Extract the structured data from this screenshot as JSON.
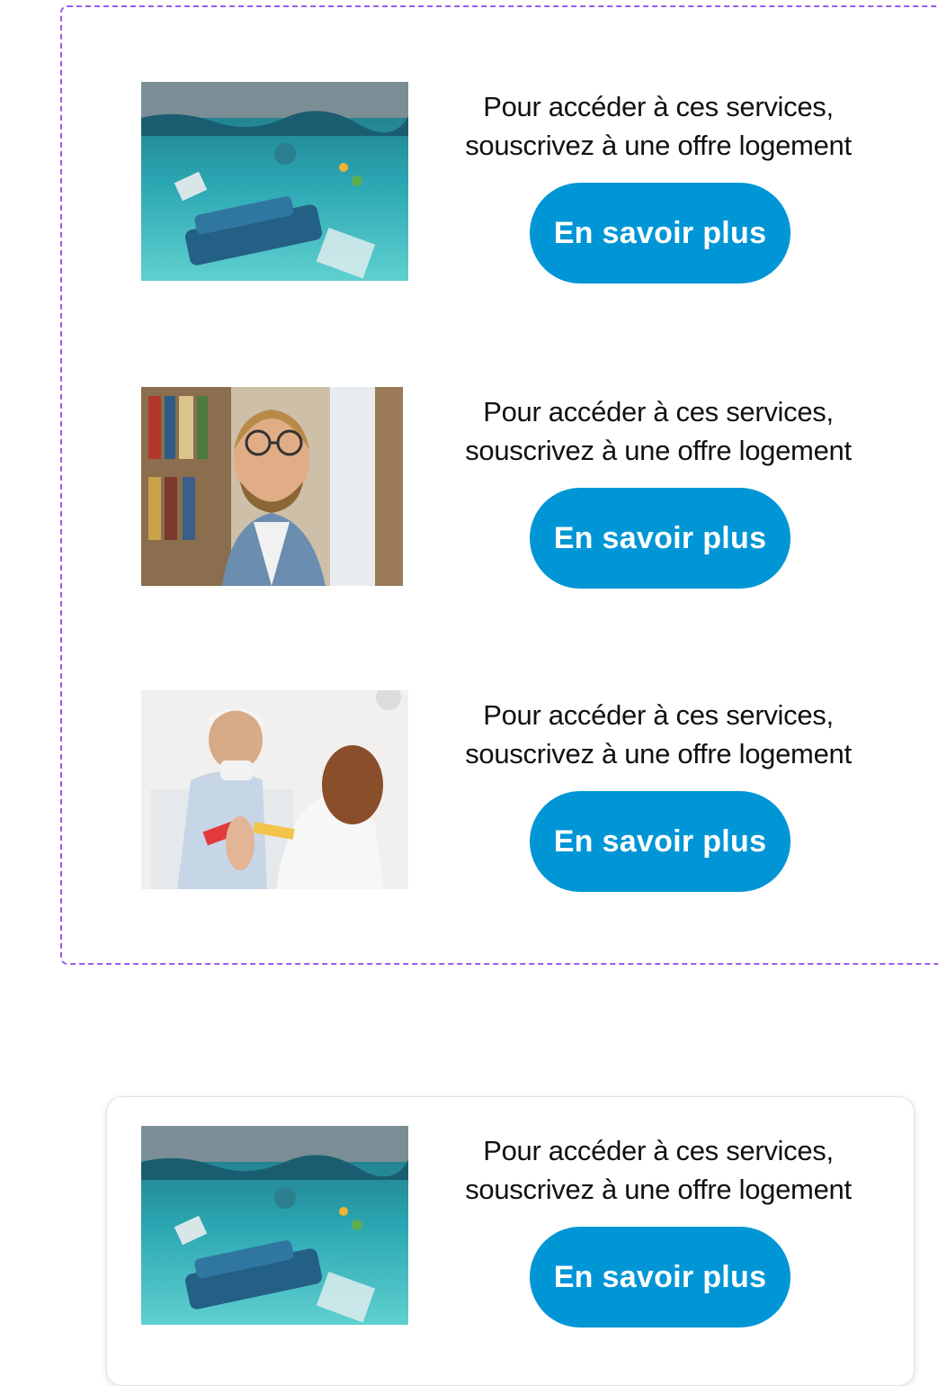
{
  "accent_color": "#0096d6",
  "frame_color": "#9b59f0",
  "cards": [
    {
      "image": "flooded-room-photo",
      "message_line1": "Pour accéder à ces services,",
      "message_line2": "souscrivez à une offre logement",
      "cta_label": "En savoir plus"
    },
    {
      "image": "man-with-broken-glasses-photo",
      "message_line1": "Pour accéder à ces services,",
      "message_line2": "souscrivez à une offre logement",
      "cta_label": "En savoir plus"
    },
    {
      "image": "injured-man-in-hospital-photo",
      "message_line1": "Pour accéder à ces services,",
      "message_line2": "souscrivez à une offre logement",
      "cta_label": "En savoir plus"
    }
  ],
  "bottom_card": {
    "image": "flooded-room-photo",
    "message_line1": "Pour accéder à ces services,",
    "message_line2": "souscrivez à une offre logement",
    "cta_label": "En savoir plus"
  }
}
